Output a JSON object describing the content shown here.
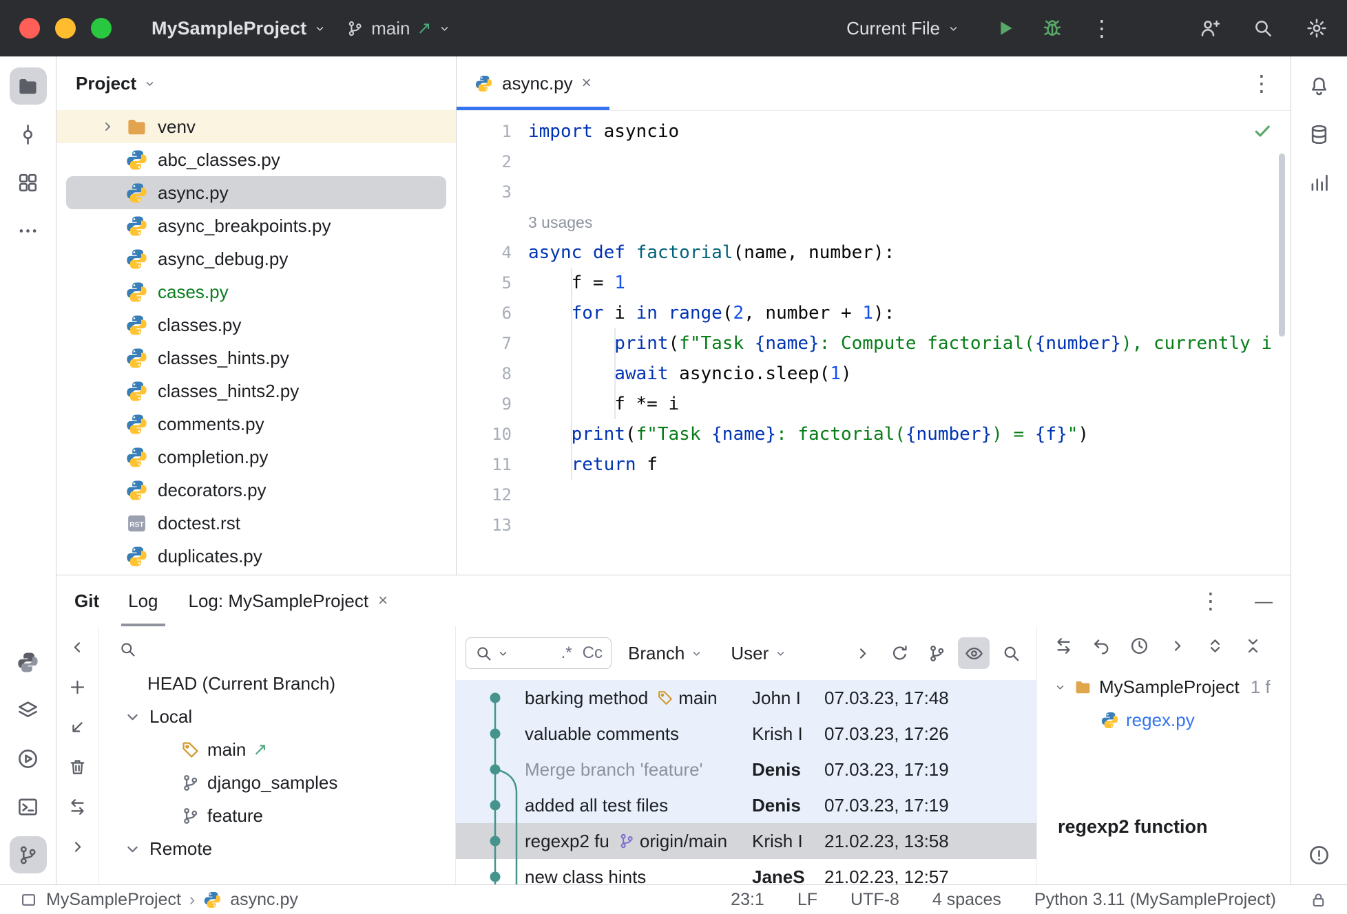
{
  "glyphs": {
    "kebab": "⋮",
    "close": "×",
    "minimize": "—",
    "arrow_up_right": "↗",
    "breadcrumb_sep": "›"
  },
  "titlebar": {
    "project_name": "MySampleProject",
    "branch_name": "main",
    "run_config": "Current File"
  },
  "activity_bar_left": {
    "top": [
      {
        "icon": "folder",
        "name": "project-tool-button",
        "active": true
      },
      {
        "icon": "commit-node",
        "name": "commit-tool-button"
      },
      {
        "icon": "structure",
        "name": "structure-tool-button"
      },
      {
        "icon": "more-h",
        "name": "more-tool-windows-button"
      }
    ],
    "bottom": [
      {
        "icon": "python-mono",
        "name": "python-packages-tool-button"
      },
      {
        "icon": "layers",
        "name": "python-console-tool-button"
      },
      {
        "icon": "play-circle",
        "name": "services-tool-button"
      },
      {
        "icon": "terminal",
        "name": "terminal-tool-button"
      },
      {
        "icon": "branch",
        "name": "version-control-tool-button",
        "active": true
      }
    ]
  },
  "activity_bar_right": {
    "top": [
      {
        "icon": "bell",
        "name": "notifications-tool-button"
      },
      {
        "icon": "database",
        "name": "database-tool-button"
      },
      {
        "icon": "chart",
        "name": "plots-tool-button"
      }
    ],
    "bottom": [
      {
        "icon": "error",
        "name": "problems-tool-button"
      }
    ]
  },
  "project_panel": {
    "title": "Project",
    "tree": [
      {
        "label": "venv",
        "icon": "folder",
        "icon_color": "#e2a44f",
        "chevron": true,
        "readonly": true
      },
      {
        "label": "abc_classes.py",
        "icon": "python"
      },
      {
        "label": "async.py",
        "icon": "python",
        "selected": true
      },
      {
        "label": "async_breakpoints.py",
        "icon": "python"
      },
      {
        "label": "async_debug.py",
        "icon": "python"
      },
      {
        "label": "cases.py",
        "icon": "python",
        "color": "#0a7d1e"
      },
      {
        "label": "classes.py",
        "icon": "python"
      },
      {
        "label": "classes_hints.py",
        "icon": "python"
      },
      {
        "label": "classes_hints2.py",
        "icon": "python"
      },
      {
        "label": "comments.py",
        "icon": "python"
      },
      {
        "label": "completion.py",
        "icon": "python"
      },
      {
        "label": "decorators.py",
        "icon": "python"
      },
      {
        "label": "doctest.rst",
        "icon": "rst"
      },
      {
        "label": "duplicates.py",
        "icon": "python"
      }
    ]
  },
  "editor": {
    "tab": {
      "label": "async.py"
    },
    "inlay": "3 usages",
    "code": [
      {
        "n": "1",
        "tokens": [
          [
            "kw",
            "import"
          ],
          [
            "pl",
            " asyncio"
          ]
        ]
      },
      {
        "n": "2",
        "tokens": []
      },
      {
        "n": "3",
        "tokens": []
      },
      {
        "n": "",
        "inlay": true
      },
      {
        "n": "4",
        "tokens": [
          [
            "kw",
            "async"
          ],
          [
            "pl",
            " "
          ],
          [
            "kw",
            "def"
          ],
          [
            "pl",
            " "
          ],
          [
            "fn",
            "factorial"
          ],
          [
            "pl",
            "(name, number):"
          ]
        ]
      },
      {
        "n": "5",
        "tokens": [
          [
            "pl",
            "    f = "
          ],
          [
            "num",
            "1"
          ]
        ]
      },
      {
        "n": "6",
        "tokens": [
          [
            "pl",
            "    "
          ],
          [
            "kw",
            "for"
          ],
          [
            "pl",
            " i "
          ],
          [
            "kw",
            "in"
          ],
          [
            "pl",
            " "
          ],
          [
            "kw",
            "range"
          ],
          [
            "pl",
            "("
          ],
          [
            "num",
            "2"
          ],
          [
            "pl",
            ", number + "
          ],
          [
            "num",
            "1"
          ],
          [
            "pl",
            "):"
          ]
        ]
      },
      {
        "n": "7",
        "tokens": [
          [
            "pl",
            "        "
          ],
          [
            "kw",
            "print"
          ],
          [
            "pl",
            "("
          ],
          [
            "str",
            "f\"Task "
          ],
          [
            "br",
            "{name}"
          ],
          [
            "str",
            ": Compute factorial("
          ],
          [
            "br",
            "{number}"
          ],
          [
            "str",
            "), currently i"
          ]
        ]
      },
      {
        "n": "8",
        "tokens": [
          [
            "pl",
            "        "
          ],
          [
            "kw",
            "await"
          ],
          [
            "pl",
            " asyncio.sleep("
          ],
          [
            "num",
            "1"
          ],
          [
            "pl",
            ")"
          ]
        ]
      },
      {
        "n": "9",
        "tokens": [
          [
            "pl",
            "        f *= i"
          ]
        ]
      },
      {
        "n": "10",
        "tokens": [
          [
            "pl",
            "    "
          ],
          [
            "kw",
            "print"
          ],
          [
            "pl",
            "("
          ],
          [
            "str",
            "f\"Task "
          ],
          [
            "br",
            "{name}"
          ],
          [
            "str",
            ": factorial("
          ],
          [
            "br",
            "{number}"
          ],
          [
            "str",
            ") = "
          ],
          [
            "br",
            "{f}"
          ],
          [
            "str",
            "\""
          ],
          [
            "pl",
            ")"
          ]
        ]
      },
      {
        "n": "11",
        "tokens": [
          [
            "pl",
            "    "
          ],
          [
            "kw",
            "return"
          ],
          [
            "pl",
            " f"
          ]
        ]
      },
      {
        "n": "12",
        "tokens": []
      },
      {
        "n": "13",
        "tokens": []
      }
    ]
  },
  "git_panel": {
    "title": "Git",
    "tabs": [
      {
        "label": "Log",
        "active": true
      },
      {
        "label": "Log: MySampleProject",
        "closable": true
      }
    ],
    "side_toolbar": [
      {
        "icon": "chevron-left",
        "name": "collapse-panel-button"
      },
      {
        "icon": "plus",
        "name": "new-branch-button"
      },
      {
        "icon": "arrow-down-left",
        "name": "checkout-button"
      },
      {
        "icon": "trash",
        "name": "delete-branch-button"
      },
      {
        "icon": "compare",
        "name": "compare-branches-button"
      },
      {
        "icon": "chevron-right",
        "name": "expand-panel-button"
      }
    ],
    "branches": [
      {
        "label": "HEAD (Current Branch)",
        "level": 1
      },
      {
        "label": "Local",
        "level": 1,
        "chevron": true
      },
      {
        "label": "main",
        "level": 2,
        "icon": "tag",
        "icon_color": "#d29a2f",
        "current": true
      },
      {
        "label": "django_samples",
        "level": 2,
        "icon": "branch"
      },
      {
        "label": "feature",
        "level": 2,
        "icon": "branch"
      },
      {
        "label": "Remote",
        "level": 1,
        "chevron": true
      }
    ],
    "log_toolbar": {
      "regex_toggle": ".*",
      "case_toggle": "Cc",
      "filters": [
        {
          "label": "Branch"
        },
        {
          "label": "User"
        }
      ],
      "buttons": [
        {
          "icon": "chevron-right",
          "name": "show-intermediate-button"
        },
        {
          "icon": "refresh",
          "name": "refresh-log-button"
        },
        {
          "icon": "branch",
          "name": "graph-options-button"
        },
        {
          "icon": "eye",
          "name": "view-options-button",
          "active": true
        },
        {
          "icon": "search",
          "name": "go-to-hash-button"
        }
      ]
    },
    "commits": [
      {
        "message": "barking method",
        "refs": [
          {
            "icon": "tag",
            "color": "#d29a2f",
            "label": "main"
          }
        ],
        "author": "John I",
        "date": "07.03.23, 17:48",
        "bg": "new"
      },
      {
        "message": "valuable comments",
        "refs": [],
        "author": "Krish I",
        "date": "07.03.23, 17:26",
        "bg": "new"
      },
      {
        "message": "Merge branch 'feature'",
        "refs": [],
        "author": "Denis",
        "date": "07.03.23, 17:19",
        "bg": "new",
        "muted": true,
        "bold_author": true
      },
      {
        "message": "added all test files",
        "refs": [],
        "author": "Denis",
        "date": "07.03.23, 17:19",
        "bg": "new",
        "bold_author": true
      },
      {
        "message": "regexp2 fu",
        "refs": [
          {
            "icon": "branch",
            "color": "#7a6fd0",
            "label": "origin/main"
          }
        ],
        "author": "Krish I",
        "date": "21.02.23, 13:58",
        "bg": "selected"
      },
      {
        "message": "new class hints",
        "refs": [],
        "author": "JaneS",
        "date": "21.02.23, 12:57",
        "bg": "plain",
        "bold_author": true
      }
    ],
    "details": {
      "toolbar": [
        {
          "icon": "compare",
          "name": "compare-with-local-button"
        },
        {
          "icon": "undo",
          "name": "revert-commit-button"
        },
        {
          "icon": "clock",
          "name": "show-history-button"
        },
        {
          "icon": "chevron-right",
          "name": "more-details-button"
        },
        {
          "icon": "expand-all",
          "name": "expand-all-button"
        },
        {
          "icon": "collapse-all",
          "name": "collapse-all-button"
        }
      ],
      "root": "MySampleProject",
      "root_badge": "1 f",
      "file": "regex.py",
      "file_color": "#3574f0",
      "commit_message": "regexp2 function"
    }
  },
  "status_bar": {
    "breadcrumb_project": "MySampleProject",
    "breadcrumb_file": "async.py",
    "caret": "23:1",
    "line_sep": "LF",
    "encoding": "UTF-8",
    "indent": "4 spaces",
    "interpreter": "Python 3.11 (MySampleProject)"
  }
}
